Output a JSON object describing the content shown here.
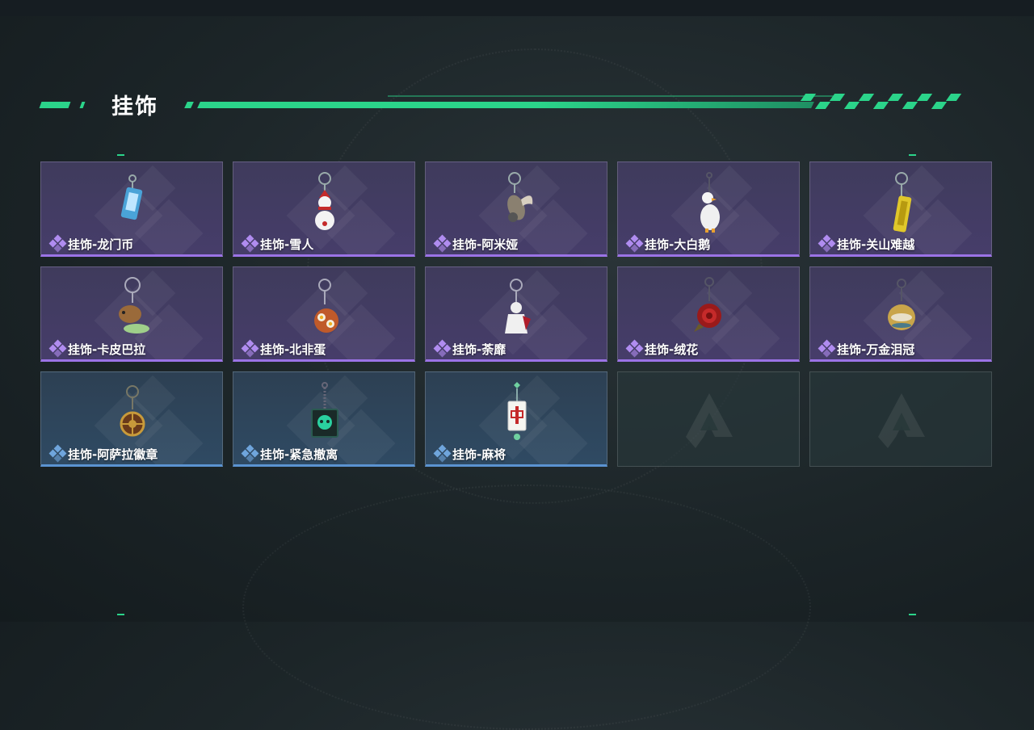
{
  "section": {
    "title": "挂饰"
  },
  "items": [
    {
      "label": "挂饰-龙门币",
      "rarity": "purple",
      "icon": "card-charm-icon"
    },
    {
      "label": "挂饰-雪人",
      "rarity": "purple",
      "icon": "snowman-charm-icon"
    },
    {
      "label": "挂饰-阿米娅",
      "rarity": "purple",
      "icon": "rabbit-plush-charm-icon"
    },
    {
      "label": "挂饰-大白鹅",
      "rarity": "purple",
      "icon": "goose-charm-icon"
    },
    {
      "label": "挂饰-关山难越",
      "rarity": "purple",
      "icon": "yellow-cylinder-charm-icon"
    },
    {
      "label": "挂饰-卡皮巴拉",
      "rarity": "purple",
      "icon": "capybara-charm-icon"
    },
    {
      "label": "挂饰-北非蛋",
      "rarity": "purple",
      "icon": "shakshuka-charm-icon"
    },
    {
      "label": "挂饰-荼靡",
      "rarity": "purple",
      "icon": "doll-charm-icon"
    },
    {
      "label": "挂饰-绒花",
      "rarity": "purple",
      "icon": "red-rose-charm-icon"
    },
    {
      "label": "挂饰-万金泪冠",
      "rarity": "purple",
      "icon": "gold-crown-charm-icon"
    },
    {
      "label": "挂饰-阿萨拉徽章",
      "rarity": "blue",
      "icon": "wheel-badge-charm-icon"
    },
    {
      "label": "挂饰-紧急撤离",
      "rarity": "blue",
      "icon": "green-skull-charm-icon"
    },
    {
      "label": "挂饰-麻将",
      "rarity": "blue",
      "icon": "mahjong-tile-charm-icon"
    },
    {
      "label": "",
      "rarity": "empty",
      "icon": "empty-slot-logo-icon"
    },
    {
      "label": "",
      "rarity": "empty",
      "icon": "empty-slot-logo-icon"
    }
  ],
  "colors": {
    "accent": "#2bd48a",
    "purple": "#9b73e6",
    "blue": "#5b93d1"
  }
}
